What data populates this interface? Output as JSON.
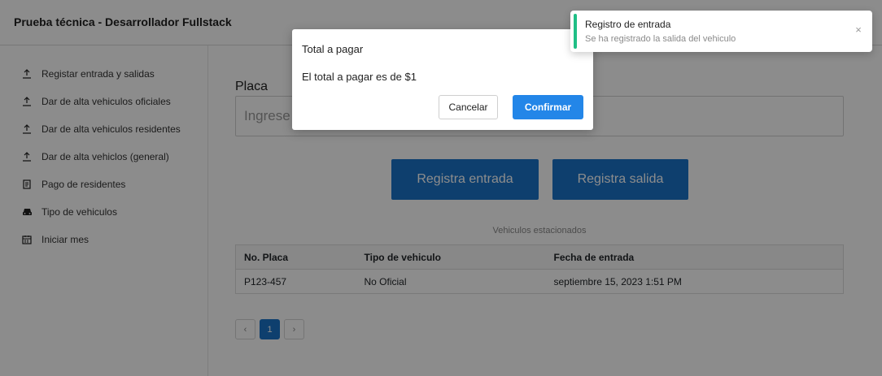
{
  "app": {
    "title": "Prueba técnica - Desarrollador Fullstack"
  },
  "sidebar": {
    "items": [
      {
        "label": "Registar entrada y salidas",
        "icon": "upload-icon"
      },
      {
        "label": "Dar de alta vehiculos oficiales",
        "icon": "upload-icon"
      },
      {
        "label": "Dar de alta vehiculos residentes",
        "icon": "upload-icon"
      },
      {
        "label": "Dar de alta vehiclos (general)",
        "icon": "upload-icon"
      },
      {
        "label": "Pago de residentes",
        "icon": "receipt-icon"
      },
      {
        "label": "Tipo de vehiculos",
        "icon": "car-icon"
      },
      {
        "label": "Iniciar mes",
        "icon": "calendar-icon"
      }
    ]
  },
  "form": {
    "placa_label": "Placa",
    "placa_placeholder": "Ingrese la placa",
    "entrada_label": "Registra entrada",
    "salida_label": "Registra salida"
  },
  "table": {
    "caption": "Vehiculos estacionados",
    "headers": [
      "No. Placa",
      "Tipo de vehiculo",
      "Fecha de entrada"
    ],
    "rows": [
      [
        "P123-457",
        "No Oficial",
        "septiembre 15, 2023 1:51 PM"
      ]
    ]
  },
  "pagination": {
    "prev": "‹",
    "current": "1",
    "next": "›"
  },
  "modal": {
    "title": "Total a pagar",
    "message": "El total a pagar es de $1",
    "cancel_label": "Cancelar",
    "confirm_label": "Confirmar"
  },
  "toast": {
    "title": "Registro de entrada",
    "message": "Se ha registrado la salida del vehiculo",
    "close": "×",
    "accent_color": "#1fbf86"
  },
  "colors": {
    "primary": "#1a73c9",
    "confirm": "#2386e8"
  }
}
